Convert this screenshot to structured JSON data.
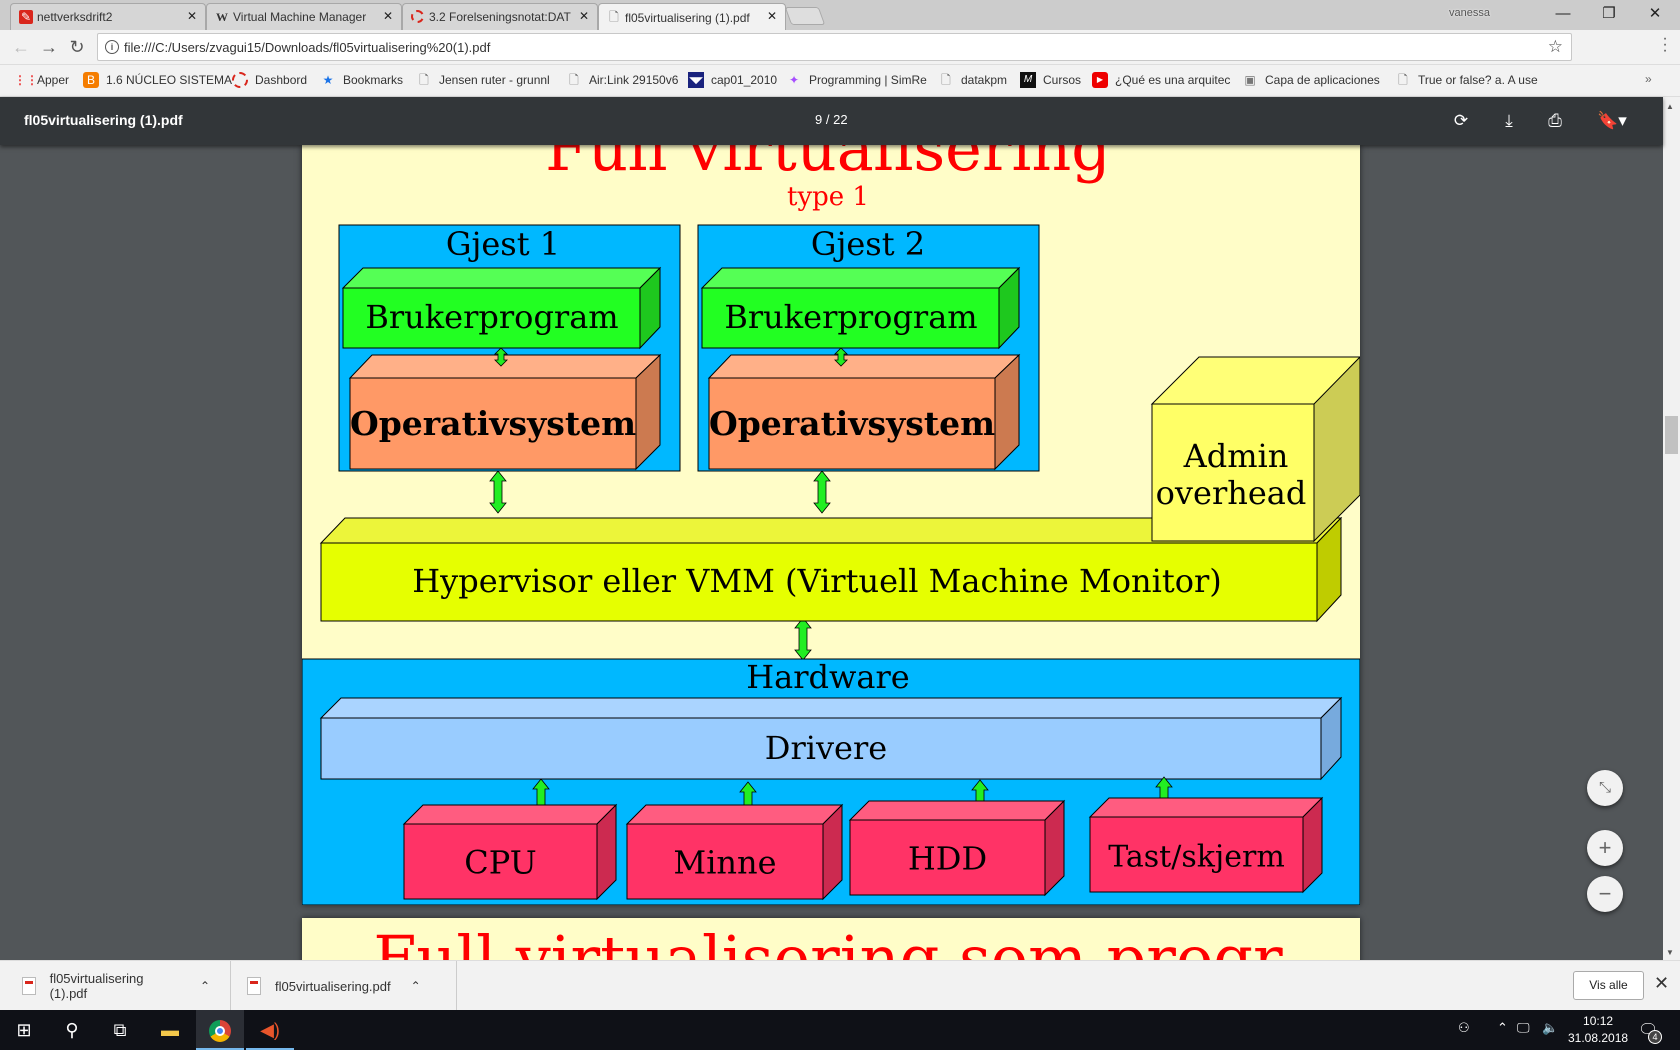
{
  "browser": {
    "tabs": [
      {
        "title": "nettverksdrift2",
        "icon": "app-red-icon"
      },
      {
        "title": "Virtual Machine Manager",
        "icon": "wikipedia-icon"
      },
      {
        "title": "3.2 Forelseningsnotat:DAT",
        "icon": "dashed-circle-icon"
      },
      {
        "title": "fl05virtualisering (1).pdf",
        "icon": "document-icon",
        "active": true
      }
    ],
    "user": "vanessa",
    "window_controls": {
      "minimize": "—",
      "restore": "❐",
      "close": "✕"
    },
    "url": "file:///C:/Users/zvagui15/Downloads/fl05virtualisering%20(1).pdf",
    "bookmarks": [
      {
        "label": "Apper",
        "icon": "apps-grid-icon"
      },
      {
        "label": "1.6 NÚCLEO SISTEMA",
        "icon": "blogger-icon"
      },
      {
        "label": "Dashbord",
        "icon": "dashed-circle-icon"
      },
      {
        "label": "Bookmarks",
        "icon": "star-icon"
      },
      {
        "label": "Jensen ruter - grunnl",
        "icon": "document-icon"
      },
      {
        "label": "Air:Link 29150v6",
        "icon": "document-icon"
      },
      {
        "label": "cap01_2010",
        "icon": "site-icon"
      },
      {
        "label": "Programming | SimRe",
        "icon": "simreal-icon"
      },
      {
        "label": "datakpm",
        "icon": "document-icon"
      },
      {
        "label": "Cursos",
        "icon": "cursos-icon"
      },
      {
        "label": "¿Qué es una arquitec",
        "icon": "youtube-icon"
      },
      {
        "label": "Capa de aplicaciones",
        "icon": "presentation-icon"
      },
      {
        "label": "True or false? a. A use",
        "icon": "document-icon"
      }
    ],
    "more_bookmarks": "»"
  },
  "pdf": {
    "filename": "fl05virtualisering (1).pdf",
    "page_current": "9",
    "page_separator": "/",
    "page_total": "22",
    "slide": {
      "title": "Full virtualisering",
      "subtitle": "type 1",
      "guests": [
        {
          "label": "Gjest 1",
          "app": "Brukerprogram",
          "os": "Operativsystem"
        },
        {
          "label": "Gjest 2",
          "app": "Brukerprogram",
          "os": "Operativsystem"
        }
      ],
      "admin": [
        "Admin",
        "overhead"
      ],
      "hypervisor": "Hypervisor eller VMM (Virtuell Machine Monitor)",
      "hardware_label": "Hardware",
      "drivers": "Drivere",
      "devices": [
        "CPU",
        "Minne",
        "HDD",
        "Tast/skjerm"
      ],
      "colors": {
        "background": "#fffdc8",
        "title": "#ff0000",
        "guest_bg": "#00b8ff",
        "app_box": "#22ff22",
        "os_box": "#ff9966",
        "hypervisor": "#e6ff00",
        "admin": "#ffff66",
        "drivers": "#99ccff",
        "device": "#ff3366",
        "arrow": "#22ee22"
      }
    },
    "next_slide_title": "Full virtualisering som progr"
  },
  "downloads": {
    "items": [
      "fl05virtualisering (1).pdf",
      "fl05virtualisering.pdf"
    ],
    "show_all": "Vis alle"
  },
  "taskbar": {
    "time": "10:12",
    "date": "31.08.2018",
    "notifications": "4"
  }
}
